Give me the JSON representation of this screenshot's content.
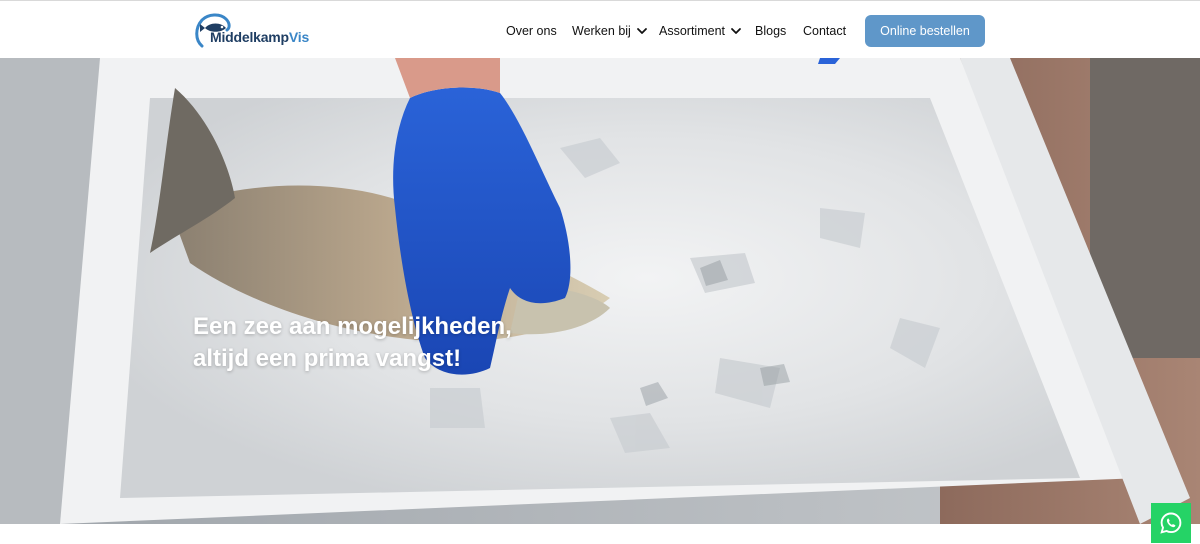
{
  "brand": {
    "part1": "Middelkamp",
    "part2": "Vis",
    "logo_icon": "fish-hook-icon",
    "colors": {
      "dark": "#1f3e63",
      "light": "#3a86c7"
    }
  },
  "nav": {
    "items": [
      {
        "label": "Over ons"
      },
      {
        "label": "Werken bij",
        "icon": "chevron-down-icon"
      },
      {
        "label": "Assortiment",
        "icon": "chevron-down-icon"
      },
      {
        "label": "Blogs"
      },
      {
        "label": "Contact"
      }
    ],
    "cta_label": "Online bestellen",
    "cta_color": "#5f97c9"
  },
  "hero": {
    "line1": "Een zee aan mogelijkheden,",
    "line2": "altijd een prima vangst!",
    "background": "fish-on-ice-photo"
  },
  "whatsapp": {
    "icon": "whatsapp-icon",
    "color": "#25d366"
  }
}
